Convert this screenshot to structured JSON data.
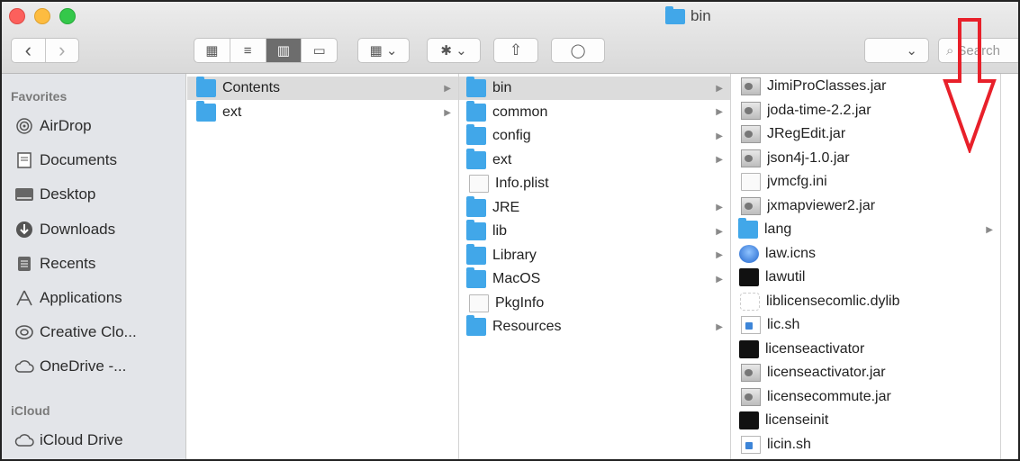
{
  "window": {
    "title": "bin"
  },
  "toolbar": {
    "nav_back": "‹",
    "nav_forward": "›",
    "view_icon": "▦",
    "view_list": "≡",
    "view_column": "▥",
    "view_gallery": "▭",
    "group_dropdown": "▦ ⌄",
    "action_dropdown": "✱ ⌄",
    "share": "⇧",
    "tag": "◯",
    "path_dropdown": "⌄",
    "search_placeholder": "Search"
  },
  "sidebar": {
    "favorites_header": "Favorites",
    "favorites": [
      {
        "label": "AirDrop",
        "icon": "airdrop-icon"
      },
      {
        "label": "Documents",
        "icon": "documents-icon"
      },
      {
        "label": "Desktop",
        "icon": "desktop-icon"
      },
      {
        "label": "Downloads",
        "icon": "downloads-icon"
      },
      {
        "label": "Recents",
        "icon": "recents-icon"
      },
      {
        "label": "Applications",
        "icon": "applications-icon"
      },
      {
        "label": "Creative Clo...",
        "icon": "creative-cloud-icon"
      },
      {
        "label": "OneDrive -...",
        "icon": "cloud-icon"
      }
    ],
    "icloud_header": "iCloud",
    "icloud": [
      {
        "label": "iCloud Drive",
        "icon": "cloud-icon"
      }
    ]
  },
  "columns": {
    "col1": [
      {
        "name": "Contents",
        "type": "folder",
        "chevron": "▶",
        "selected": true
      },
      {
        "name": "ext",
        "type": "folder",
        "chevron": "▶"
      }
    ],
    "col2": [
      {
        "name": "bin",
        "type": "folder",
        "chevron": "▶",
        "selected": true
      },
      {
        "name": "common",
        "type": "folder",
        "chevron": "▶"
      },
      {
        "name": "config",
        "type": "folder",
        "chevron": "▶"
      },
      {
        "name": "ext",
        "type": "folder",
        "chevron": "▶"
      },
      {
        "name": "Info.plist",
        "type": "doc"
      },
      {
        "name": "JRE",
        "type": "folder",
        "chevron": "▶"
      },
      {
        "name": "lib",
        "type": "folder",
        "chevron": "▶"
      },
      {
        "name": "Library",
        "type": "folder",
        "chevron": "▶"
      },
      {
        "name": "MacOS",
        "type": "folder",
        "chevron": "▶"
      },
      {
        "name": "PkgInfo",
        "type": "doc"
      },
      {
        "name": "Resources",
        "type": "folder",
        "chevron": "▶"
      }
    ],
    "col3": [
      {
        "name": "JimiProClasses.jar",
        "type": "jar"
      },
      {
        "name": "joda-time-2.2.jar",
        "type": "jar"
      },
      {
        "name": "JRegEdit.jar",
        "type": "jar"
      },
      {
        "name": "json4j-1.0.jar",
        "type": "jar"
      },
      {
        "name": "jvmcfg.ini",
        "type": "doc"
      },
      {
        "name": "jxmapviewer2.jar",
        "type": "jar"
      },
      {
        "name": "lang",
        "type": "folder",
        "chevron": "▶"
      },
      {
        "name": "law.icns",
        "type": "icns"
      },
      {
        "name": "lawutil",
        "type": "term"
      },
      {
        "name": "liblicensecomlic.dylib",
        "type": "dylib"
      },
      {
        "name": "lic.sh",
        "type": "sh"
      },
      {
        "name": "licenseactivator",
        "type": "term"
      },
      {
        "name": "licenseactivator.jar",
        "type": "jar"
      },
      {
        "name": "licensecommute.jar",
        "type": "jar"
      },
      {
        "name": "licenseinit",
        "type": "term"
      },
      {
        "name": "licin.sh",
        "type": "sh"
      }
    ]
  },
  "colors": {
    "annotation_arrow": "#e8202a",
    "folder": "#41a7e9",
    "sidebar_bg": "#e3e5e9"
  }
}
